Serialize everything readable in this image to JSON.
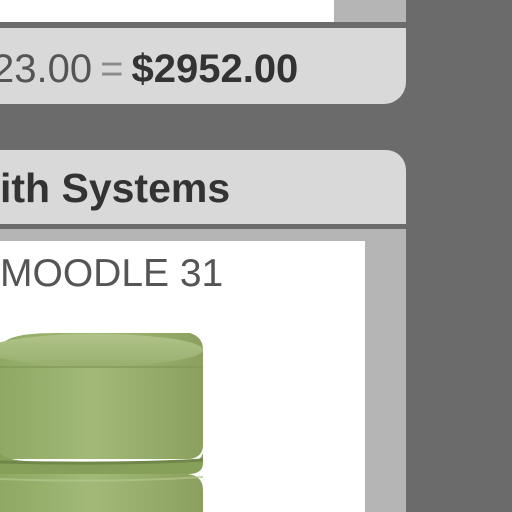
{
  "summary": {
    "left_amount": "23.00",
    "equals_sign": "=",
    "total_amount": "$2952.00"
  },
  "section": {
    "title": "ith Systems"
  },
  "product": {
    "name": "MOODLE 31",
    "image_icon": "green-cylinder-product-image"
  },
  "colors": {
    "background": "#6b6b6b",
    "panel": "#d9d9d9",
    "card": "#ffffff",
    "card_frame": "#b5b5b5",
    "text_dark": "#333333",
    "text_mid": "#555555",
    "product_green": "#9bb36a"
  }
}
